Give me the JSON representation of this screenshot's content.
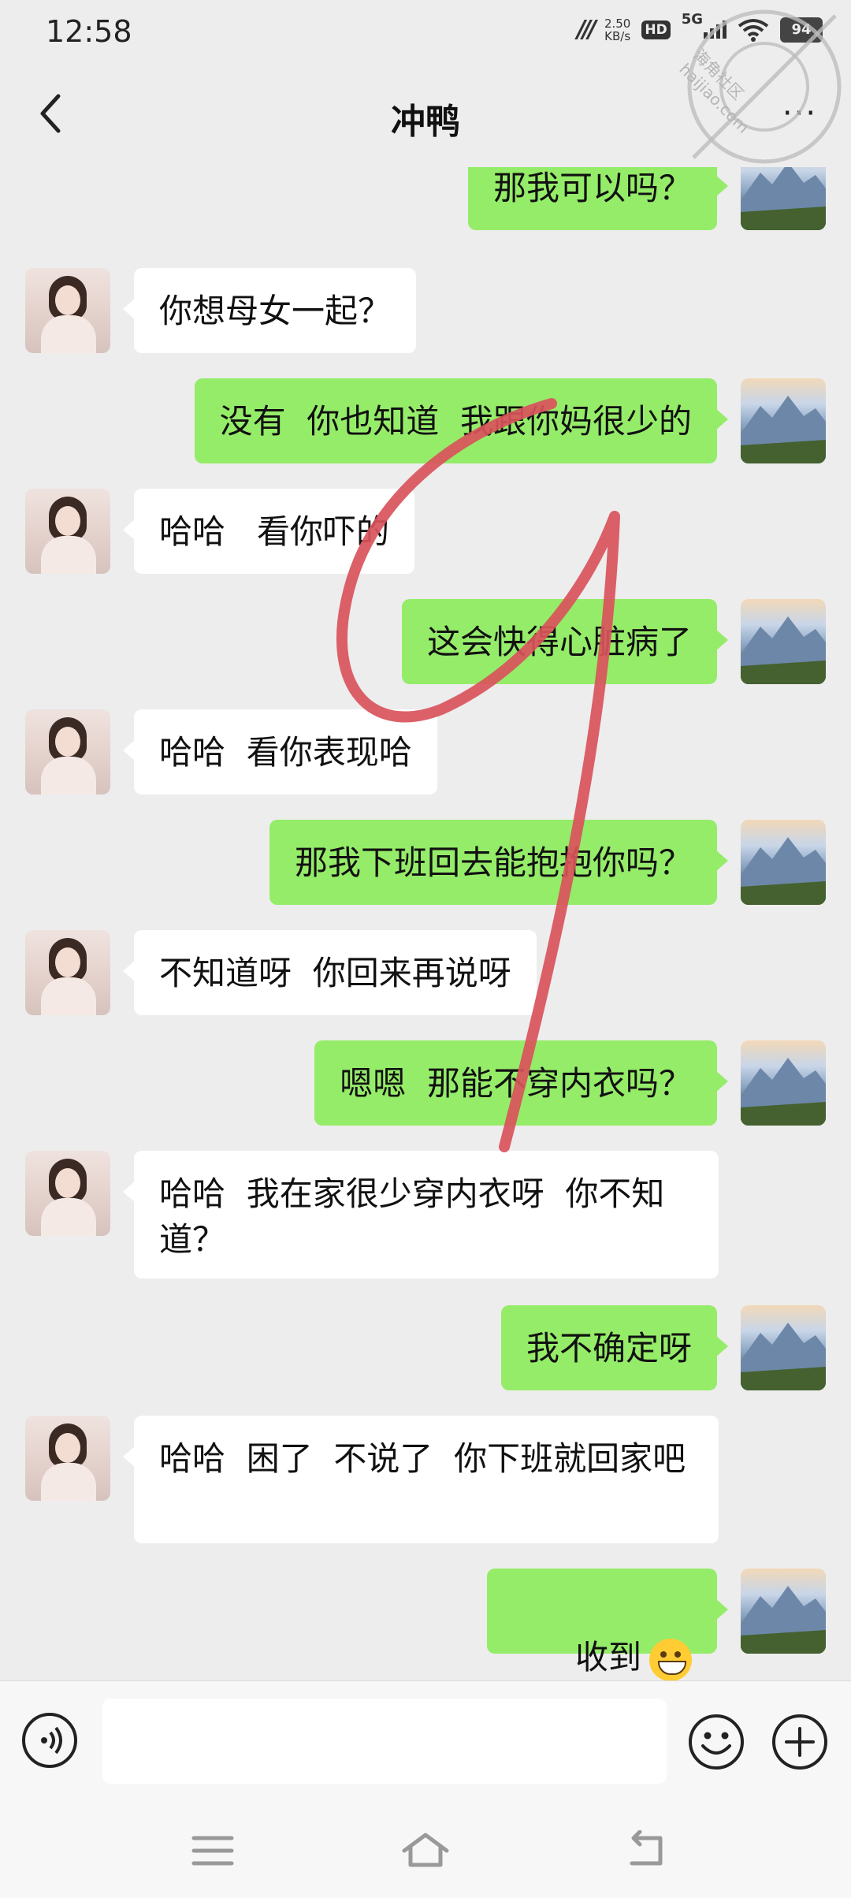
{
  "status_bar": {
    "time": "12:58",
    "network_speed_value": "2.50",
    "network_speed_unit": "KB/s",
    "hd_badge": "HD",
    "signal_type": "5G",
    "battery_level": "94"
  },
  "header": {
    "title": "冲鸭",
    "more_label": "···"
  },
  "watermark": {
    "text": "海角社区 haijiao.com"
  },
  "messages": [
    {
      "side": "right",
      "text": "那我可以吗？"
    },
    {
      "side": "left",
      "text": "你想母女一起？"
    },
    {
      "side": "right",
      "text": "没有  你也知道  我跟你妈很少的"
    },
    {
      "side": "left",
      "text": "哈哈   看你吓的"
    },
    {
      "side": "right",
      "text": "这会快得心脏病了"
    },
    {
      "side": "left",
      "text": "哈哈  看你表现哈"
    },
    {
      "side": "right",
      "text": "那我下班回去能抱抱你吗？"
    },
    {
      "side": "left",
      "text": "不知道呀  你回来再说呀"
    },
    {
      "side": "right",
      "text": "嗯嗯  那能不穿内衣吗？"
    },
    {
      "side": "left",
      "text": "哈哈  我在家很少穿内衣呀  你不知道？"
    },
    {
      "side": "right",
      "text": "我不确定呀"
    },
    {
      "side": "left",
      "text": "哈哈  困了  不说了  你下班就回家吧"
    },
    {
      "side": "right",
      "text": "收到",
      "emoji": "grinning-face"
    }
  ],
  "input_bar": {
    "placeholder": "",
    "voice_icon": "voice-icon",
    "emoji_icon": "smile-icon",
    "plus_icon": "plus-icon"
  },
  "colors": {
    "background": "#EDEDED",
    "outgoing_bubble": "#95EC69",
    "incoming_bubble": "#FFFFFF",
    "scribble": "#D9535B"
  }
}
